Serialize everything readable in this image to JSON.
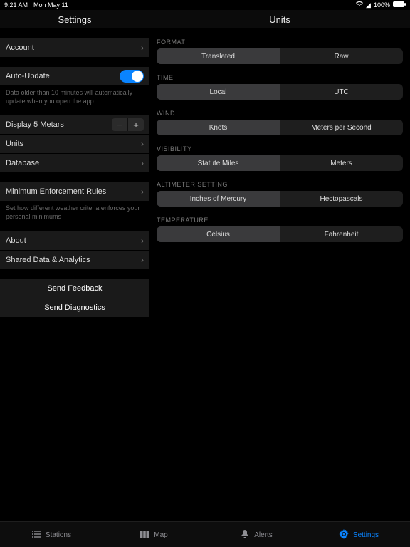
{
  "status": {
    "time": "9:21 AM",
    "date": "Mon May 11",
    "battery": "100%"
  },
  "sidebar": {
    "title": "Settings",
    "account_label": "Account",
    "auto_update_label": "Auto-Update",
    "auto_update_desc": "Data older than 10 minutes will automatically update when you open the app",
    "display_metars_label": "Display 5 Metars",
    "units_label": "Units",
    "database_label": "Database",
    "min_rules_label": "Minimum Enforcement Rules",
    "min_rules_desc": "Set how different weather criteria enforces your personal minimums",
    "about_label": "About",
    "shared_data_label": "Shared Data & Analytics",
    "send_feedback_label": "Send Feedback",
    "send_diagnostics_label": "Send Diagnostics"
  },
  "detail": {
    "title": "Units",
    "groups": [
      {
        "label": "FORMAT",
        "options": [
          "Translated",
          "Raw"
        ],
        "selected": 0
      },
      {
        "label": "TIME",
        "options": [
          "Local",
          "UTC"
        ],
        "selected": 0
      },
      {
        "label": "WIND",
        "options": [
          "Knots",
          "Meters per Second"
        ],
        "selected": 0
      },
      {
        "label": "VISIBILITY",
        "options": [
          "Statute Miles",
          "Meters"
        ],
        "selected": 0
      },
      {
        "label": "ALTIMETER SETTING",
        "options": [
          "Inches of Mercury",
          "Hectopascals"
        ],
        "selected": 0
      },
      {
        "label": "TEMPERATURE",
        "options": [
          "Celsius",
          "Fahrenheit"
        ],
        "selected": 0
      }
    ]
  },
  "tabs": {
    "stations": "Stations",
    "map": "Map",
    "alerts": "Alerts",
    "settings": "Settings",
    "active": "settings"
  }
}
